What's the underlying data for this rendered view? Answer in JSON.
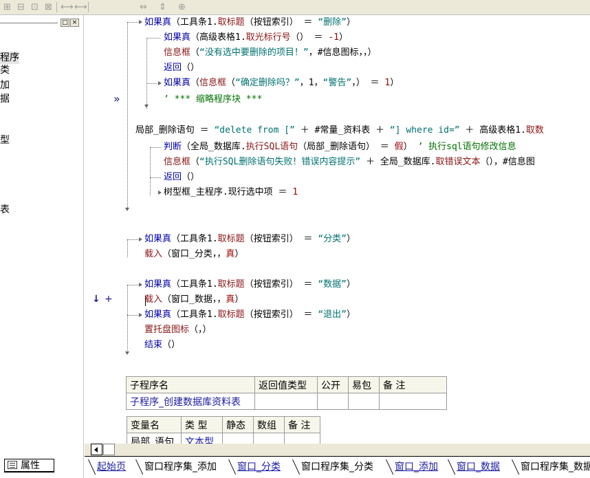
{
  "toolbar": {
    "icons": [
      "table-layout-icon",
      "merge-icon",
      "split-icon",
      "grid-icon",
      "align-h-icon",
      "align-v-icon",
      "width-icon",
      "height-icon",
      "center-icon"
    ],
    "glyphs": [
      "⊞",
      "⊟",
      "⊡",
      "⊠",
      "⟷",
      "⟷",
      "⇔",
      "⇕",
      "⊕"
    ]
  },
  "left_panel": {
    "close_label": "×",
    "min_label": "□",
    "items": [
      "程序",
      "类",
      "加",
      "据",
      "型",
      "表"
    ],
    "properties_tab": "属性"
  },
  "gutter": {
    "bookmark_marker": "»",
    "breakpoint_arrow": "↓",
    "breakpoint_plus": "+"
  },
  "code": {
    "l1": {
      "a": "如果真",
      "b": "（工具条1.",
      "c": "取标题",
      "d": "（按钮索引） ＝ ",
      "e": "“删除”",
      "f": "）"
    },
    "l2": {
      "a": "如果真",
      "b": "（高级表格1.",
      "c": "取光标行号",
      "d": "（） ＝ ",
      "e": "-1",
      "f": "）"
    },
    "l3": {
      "a": "信息框",
      "b": "（",
      "c": "“没有选中要删除的项目！”",
      "d": "，#信息图标，，）"
    },
    "l4": {
      "a": "返回",
      "b": "（）"
    },
    "l5": {
      "a": "如果真",
      "b": "（",
      "c": "信息框",
      "d": "（",
      "e": "“确定删除吗？”",
      "f": "，1，",
      "g": "“警告”",
      "h": "，） ＝ ",
      "i": "1",
      "j": "）"
    },
    "l6": {
      "a": "’ *** 缩略程序块 ***"
    },
    "l7": {
      "a": "局部_删除语句 ＝ ",
      "b": "“delete from [”",
      "c": " ＋ #常量_资料表 ＋ ",
      "d": "“] where id=”",
      "e": " ＋ 高级表格1.",
      "f": "取数"
    },
    "l8": {
      "a": "判断",
      "b": "（全局_数据库.",
      "c": "执行SQL语句",
      "d": "（局部_删除语句） ＝ ",
      "e": "假",
      "f": "） ",
      "g": "’ 执行sql语句修改信息"
    },
    "l9": {
      "a": "信息框",
      "b": "（",
      "c": "“执行SQL删除语句失败！错误内容提示”",
      "d": " ＋ 全局_数据库.",
      "e": "取错误文本",
      "f": "（），#信息图"
    },
    "l10": {
      "a": "返回",
      "b": "（）"
    },
    "l11": {
      "a": "树型框_主程序.现行选中项 ＝ ",
      "b": "1"
    },
    "l12": {
      "a": "如果真",
      "b": "（工具条1.",
      "c": "取标题",
      "d": "（按钮索引） ＝ ",
      "e": "“分类”",
      "f": "）"
    },
    "l13": {
      "a": "载入",
      "b": "（窗口_分类，，",
      "c": "真",
      "d": "）"
    },
    "l14": {
      "a": "如果真",
      "b": "（工具条1.",
      "c": "取标题",
      "d": "（按钮索引） ＝ ",
      "e": "“数据”",
      "f": "）"
    },
    "l15": {
      "a": "载入",
      "b": "（窗口_数据，，",
      "c": "真",
      "d": "）"
    },
    "l16": {
      "a": "如果真",
      "b": "（工具条1.",
      "c": "取标题",
      "d": "（按钮索引） ＝ ",
      "e": "“退出”",
      "f": "）"
    },
    "l17": {
      "a": "置托盘图标",
      "b": "（，）"
    },
    "l18": {
      "a": "结束",
      "b": "（）"
    }
  },
  "sub_table": {
    "headers": [
      "子程序名",
      "返回值类型",
      "公开",
      "易包",
      "备 注"
    ],
    "rows": [
      [
        "子程序_创建数据库资料表",
        "",
        "",
        "",
        ""
      ]
    ]
  },
  "var_table": {
    "headers": [
      "变量名",
      "类 型",
      "静态",
      "数组",
      "备 注"
    ],
    "rows": [
      [
        "局部_语句",
        "文本型",
        "",
        "",
        ""
      ]
    ]
  },
  "tabs": [
    "起始页",
    "窗口程序集_添加",
    "窗口_分类",
    "窗口程序集_分类",
    "窗口_添加",
    "窗口_数据",
    "窗口程序集_数据"
  ],
  "colors": {
    "keyword": "#0000aa",
    "function": "#8a1414",
    "string": "#007070",
    "comment": "#007000",
    "link": "#1a1aa0"
  }
}
